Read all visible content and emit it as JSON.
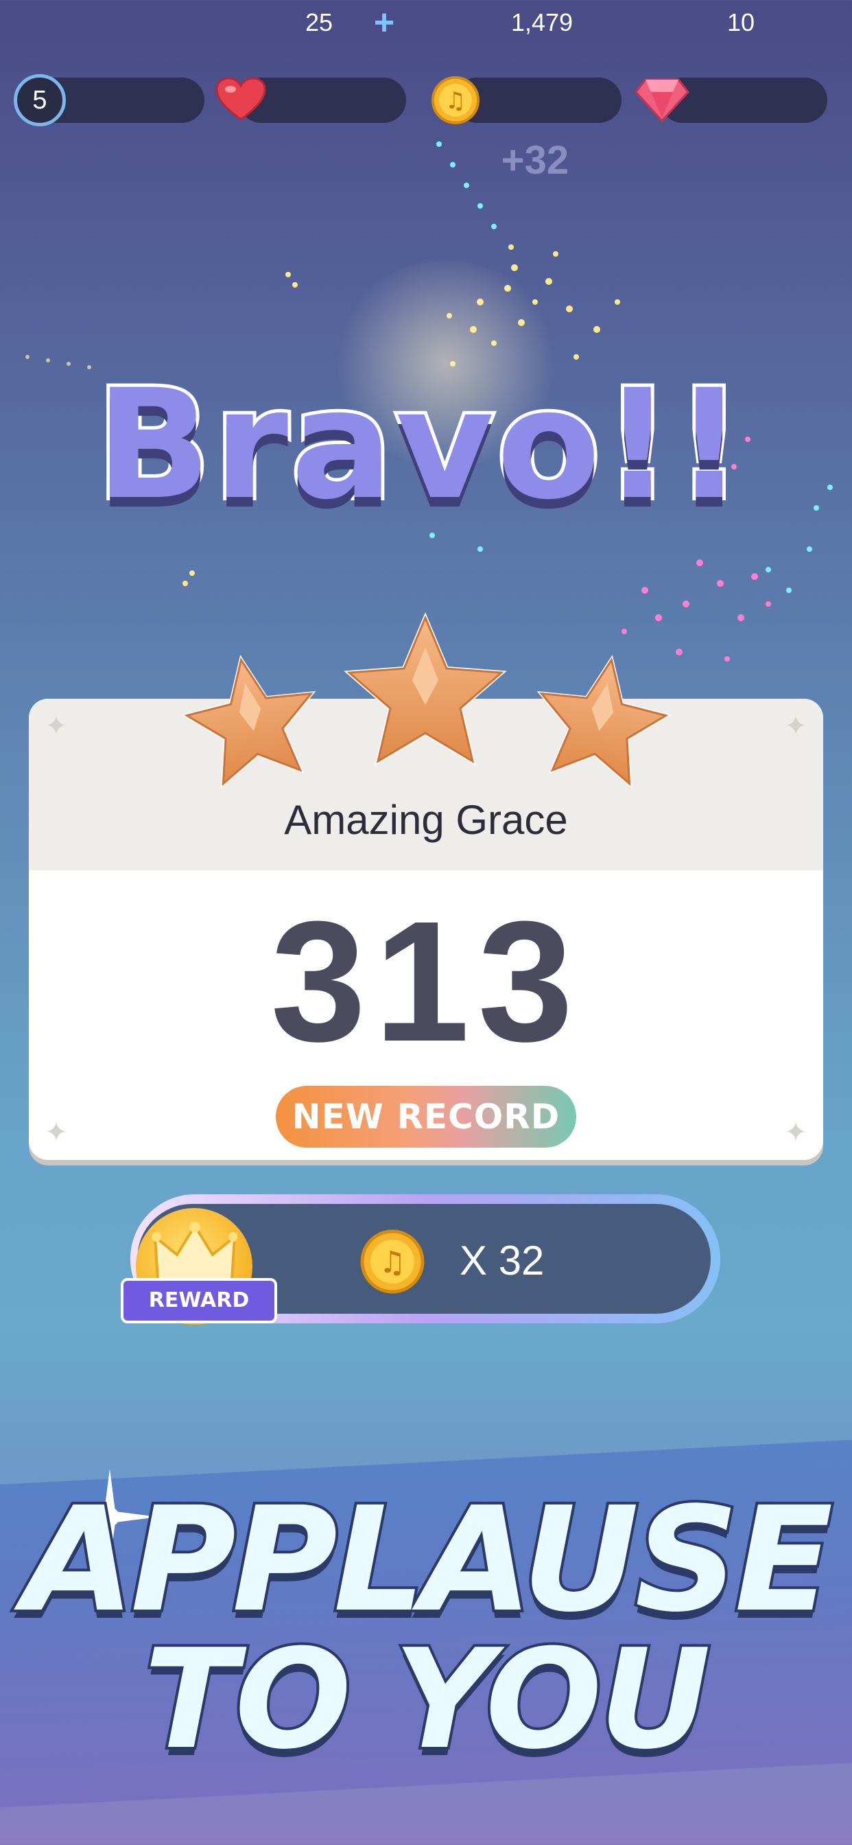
{
  "top_bar": {
    "level": "5",
    "hearts": "25",
    "hearts_add": "+",
    "coins": "1,479",
    "gems": "10",
    "coins_gained": "+32"
  },
  "result": {
    "headline": "Bravo!!",
    "stars_earned": 3,
    "stars_total": 3,
    "song_title": "Amazing Grace",
    "score": "313",
    "badge": "NEW RECORD"
  },
  "reward": {
    "label": "REWARD",
    "amount": "X 32"
  },
  "banner": {
    "line1": "APPLAUSE",
    "line2": "TO YOU"
  },
  "colors": {
    "coin": "#f6b52a",
    "heart": "#e8404e",
    "gem": "#f0607e",
    "star": "#e99a5c",
    "reward_purple": "#6f5ae0"
  }
}
